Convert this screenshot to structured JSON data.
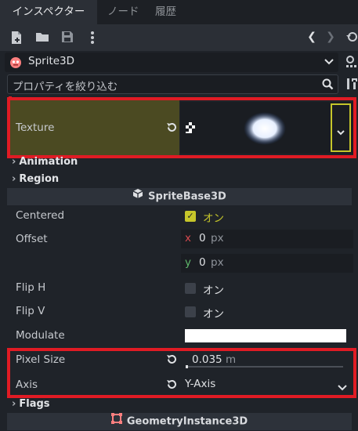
{
  "tabs": [
    "インスペクター",
    "ノード",
    "履歴"
  ],
  "toolbar": {
    "icons": [
      "new-script-icon",
      "open-icon",
      "save-icon",
      "more-icon"
    ],
    "history_back": "❮",
    "history_forward": "❯"
  },
  "object": {
    "name": "Sprite3D"
  },
  "filter": {
    "placeholder": "プロパティを絞り込む"
  },
  "texture": {
    "label": "Texture"
  },
  "groups": {
    "animation": "Animation",
    "region": "Region",
    "flags": "Flags"
  },
  "sections": {
    "sprite_base": "SpriteBase3D",
    "geometry": "GeometryInstance3D"
  },
  "props": {
    "centered": {
      "label": "Centered",
      "value": "オン",
      "checked": true
    },
    "offset": {
      "label": "Offset",
      "x_axis": "x",
      "x": "0",
      "y_axis": "y",
      "y": "0",
      "unit": "px"
    },
    "flip_h": {
      "label": "Flip H",
      "value": "オン",
      "checked": false
    },
    "flip_v": {
      "label": "Flip V",
      "value": "オン",
      "checked": false
    },
    "modulate": {
      "label": "Modulate",
      "color": "#ffffff"
    },
    "pixel_size": {
      "label": "Pixel Size",
      "value": "0.035",
      "unit": "m"
    },
    "axis": {
      "label": "Axis",
      "value": "Y-Axis"
    }
  },
  "colors": {
    "accent": "#c6c62a",
    "highlight": "#e01b24",
    "texture_row": "#4b4a22"
  }
}
